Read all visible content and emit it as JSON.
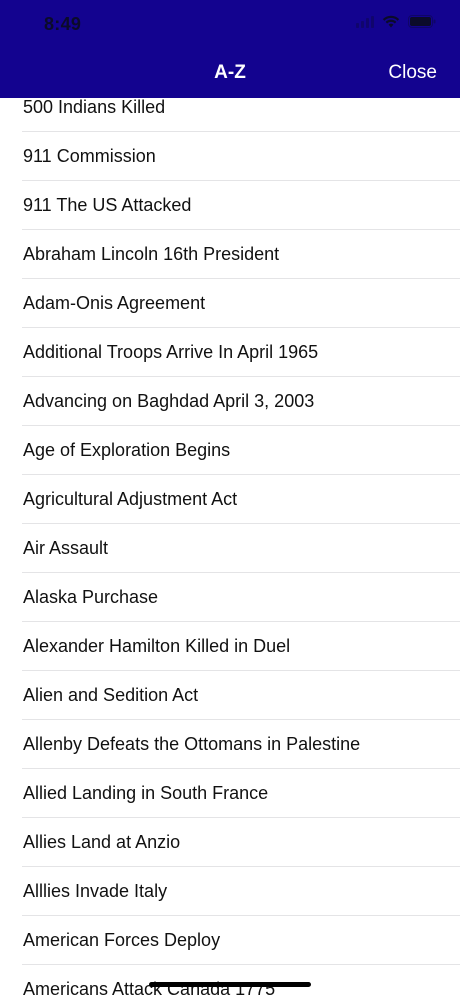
{
  "status_bar": {
    "time": "8:49"
  },
  "navbar": {
    "title": "A-Z",
    "close_label": "Close",
    "background_color": "#13038f"
  },
  "items": [
    "500 Indians Killed",
    "911 Commission",
    "911 The US Attacked",
    "Abraham Lincoln 16th President",
    "Adam-Onis Agreement",
    "Additional Troops Arrive In April 1965",
    "Advancing on Baghdad April 3, 2003",
    "Age of Exploration Begins",
    "Agricultural Adjustment Act",
    "Air Assault",
    "Alaska Purchase",
    "Alexander Hamilton Killed in Duel",
    "Alien and Sedition Act",
    "Allenby Defeats the Ottomans in Palestine",
    "Allied Landing in South France",
    "Allies Land at Anzio",
    "Alllies Invade Italy",
    "American Forces Deploy",
    "Americans Attack Canada 1775"
  ]
}
